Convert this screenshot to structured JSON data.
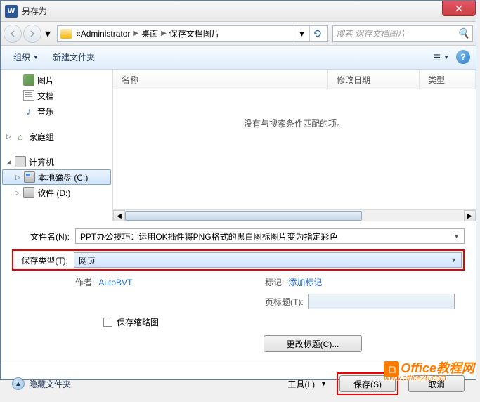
{
  "title": "另存为",
  "titleIcon": "W",
  "breadcrumbs": {
    "prefix": "«",
    "items": [
      "Administrator",
      "桌面",
      "保存文档图片"
    ]
  },
  "search": {
    "placeholder": "搜索 保存文档图片"
  },
  "toolbar": {
    "organize": "组织",
    "newFolder": "新建文件夹"
  },
  "sidebar": {
    "pictures": "图片",
    "documents": "文档",
    "music": "音乐",
    "homegroup": "家庭组",
    "computer": "计算机",
    "driveC": "本地磁盘 (C:)",
    "driveD": "软件 (D:)"
  },
  "columns": {
    "name": "名称",
    "date": "修改日期",
    "type": "类型"
  },
  "emptyMessage": "没有与搜索条件匹配的项。",
  "form": {
    "filenameLabel": "文件名(N):",
    "filenameValue": "PPT办公技巧：运用OK插件将PNG格式的黑白图标图片变为指定彩色",
    "filetypeLabel": "保存类型(T):",
    "filetypeValue": "网页",
    "authorLabel": "作者:",
    "authorValue": "AutoBVT",
    "tagsLabel": "标记:",
    "tagsValue": "添加标记",
    "pageTitleLabel": "页标题(T):",
    "saveThumb": "保存缩略图",
    "changeTitle": "更改标题(C)..."
  },
  "bottom": {
    "hideFolders": "隐藏文件夹",
    "tools": "工具(L)",
    "save": "保存(S)",
    "cancel": "取消"
  },
  "watermark": {
    "brand": "Office教程网",
    "url": "www.office26.com"
  }
}
